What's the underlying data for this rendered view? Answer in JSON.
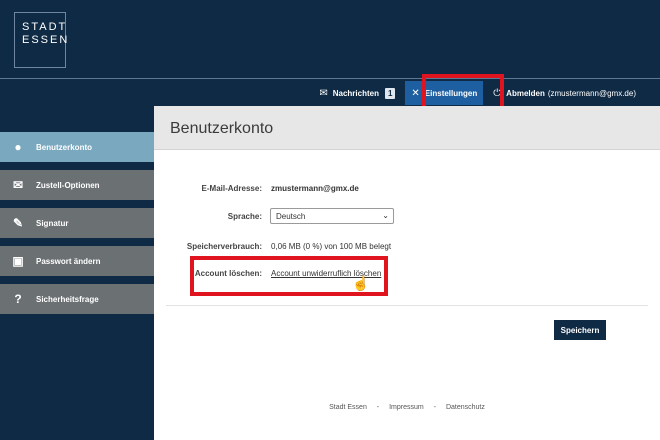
{
  "brand": {
    "line1": "STADT",
    "line2": "ESSEN"
  },
  "topnav": {
    "messages_label": "Nachrichten",
    "messages_count": "1",
    "settings_label": "Einstellungen",
    "logout_label": "Abmelden",
    "logout_user": "(zmustermann@gmx.de)"
  },
  "sidebar": {
    "items": [
      {
        "label": "Benutzerkonto",
        "icon": "user-icon"
      },
      {
        "label": "Zustell-Optionen",
        "icon": "envelope-icon"
      },
      {
        "label": "Signatur",
        "icon": "pen-icon"
      },
      {
        "label": "Passwort ändern",
        "icon": "lock-icon"
      },
      {
        "label": "Sicherheitsfrage",
        "icon": "question-icon"
      }
    ]
  },
  "main": {
    "title": "Benutzerkonto",
    "email_label": "E-Mail-Adresse:",
    "email_value": "zmustermann@gmx.de",
    "language_label": "Sprache:",
    "language_value": "Deutsch",
    "storage_label": "Speicherverbrauch:",
    "storage_value": "0,06 MB (0 %) von 100 MB belegt",
    "delete_label": "Account löschen:",
    "delete_link": "Account unwiderruflich löschen",
    "save_label": "Speichern"
  },
  "footer": {
    "brand": "Stadt Essen",
    "sep1": "-",
    "imprint": "Impressum",
    "sep2": "-",
    "privacy": "Datenschutz"
  },
  "colors": {
    "navy": "#0f2a44",
    "active_tab": "#1d5fa0",
    "highlight": "#e0141e",
    "sidebar_active": "#7aa8bf",
    "sidebar_item": "#6b7073"
  }
}
